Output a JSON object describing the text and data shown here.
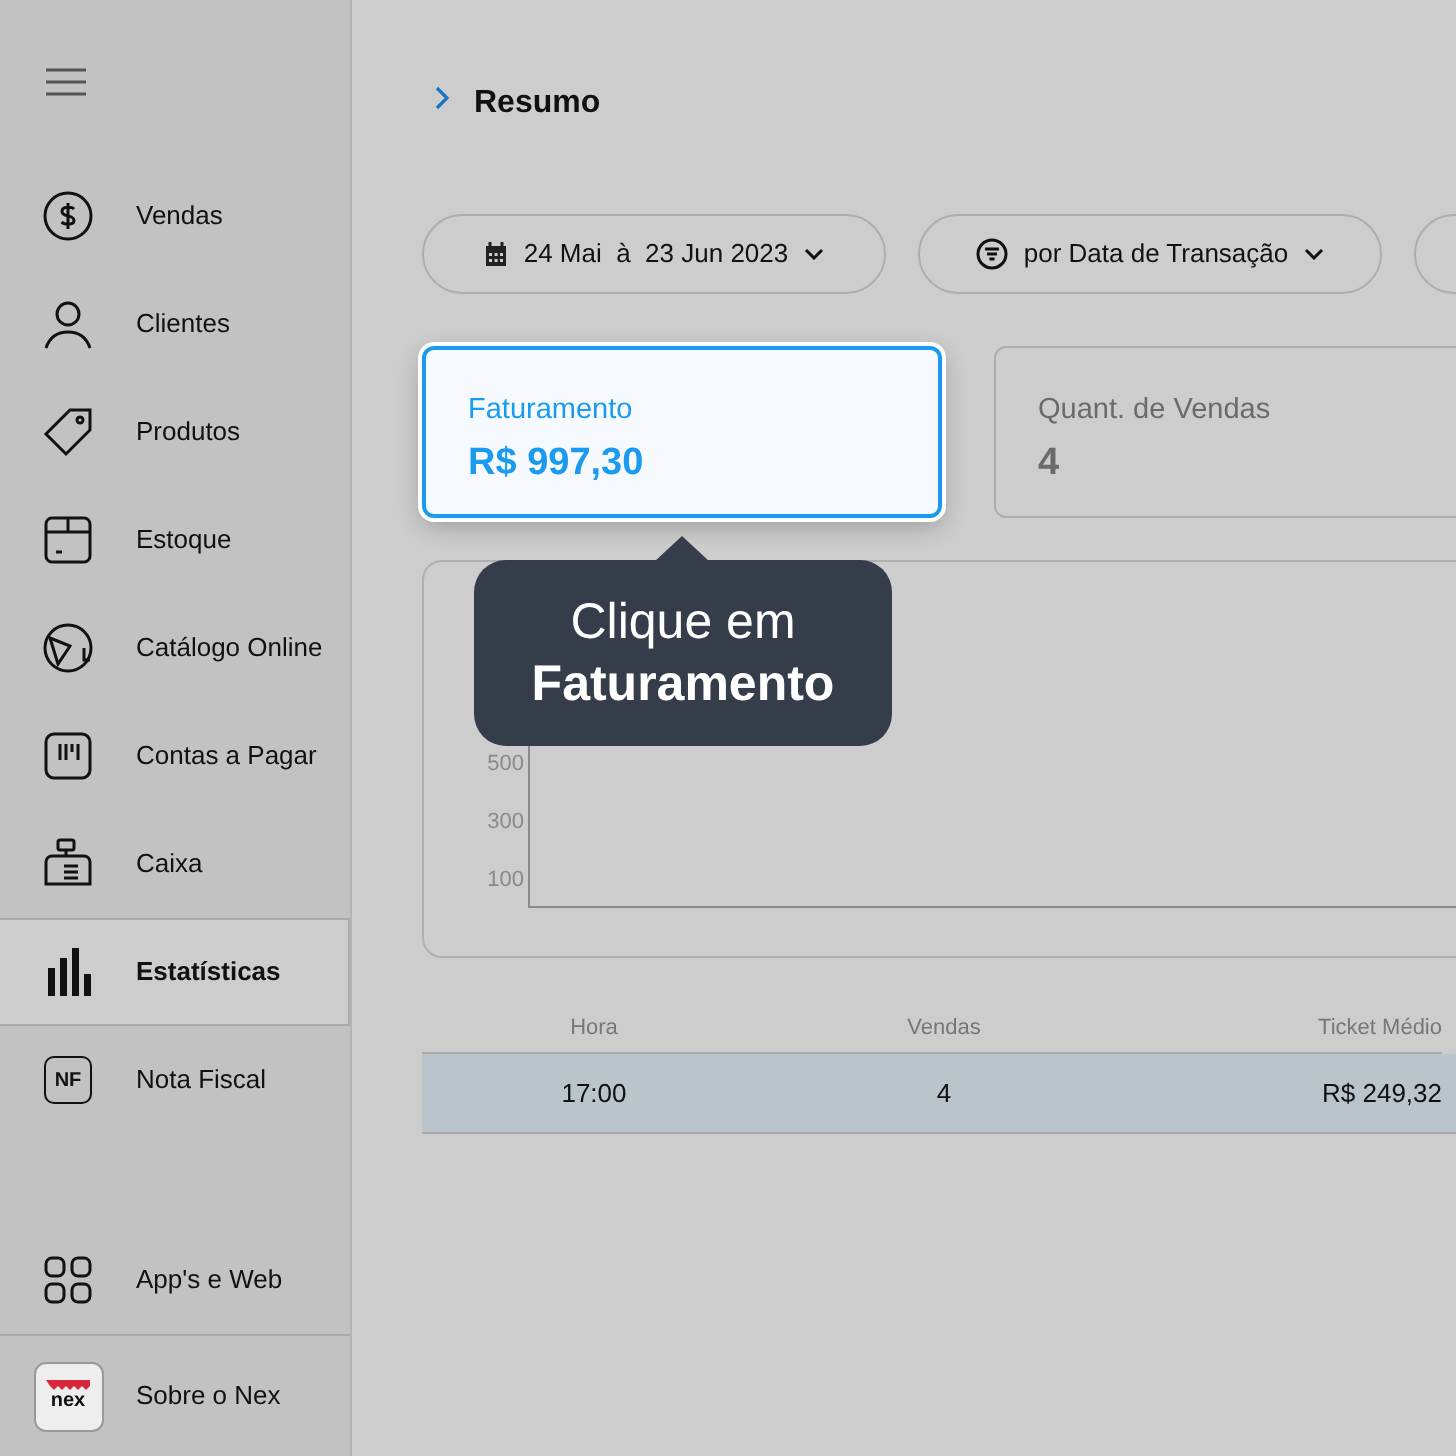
{
  "sidebar": {
    "items": [
      {
        "label": "Vendas",
        "kind": "dollar",
        "selected": false
      },
      {
        "label": "Clientes",
        "kind": "person",
        "selected": false
      },
      {
        "label": "Produtos",
        "kind": "tag",
        "selected": false
      },
      {
        "label": "Estoque",
        "kind": "box",
        "selected": false
      },
      {
        "label": "Catálogo Online",
        "kind": "catalog",
        "selected": false
      },
      {
        "label": "Contas a Pagar",
        "kind": "bill",
        "selected": false
      },
      {
        "label": "Caixa",
        "kind": "register",
        "selected": false
      },
      {
        "label": "Estatísticas",
        "kind": "bars",
        "selected": true
      },
      {
        "label": "Nota Fiscal",
        "kind": "nf",
        "icon_text": "NF",
        "selected": false
      }
    ],
    "apps": {
      "label": "App's e Web"
    },
    "about": {
      "label": "Sobre o Nex",
      "logo_text": "nex"
    }
  },
  "header": {
    "title": "Resumo"
  },
  "filters": [
    {
      "label": "24 Mai  à  23 Jun 2023",
      "kind": "calendar"
    },
    {
      "label": "por Data de Transação",
      "kind": "filter"
    }
  ],
  "cards": [
    {
      "title": "Faturamento",
      "value": "R$ 997,30",
      "selected": true
    },
    {
      "title": "Quant. de Vendas",
      "value": "4",
      "selected": false
    }
  ],
  "chart": {
    "y_ticks": [
      "500",
      "300",
      "100"
    ]
  },
  "tooltip": {
    "text": "Clique em\n**Faturamento**"
  },
  "table": {
    "columns": [
      "Hora",
      "Vendas",
      "Ticket Médio"
    ],
    "rows": [
      [
        "17:00",
        "4",
        "R$ 249,32"
      ]
    ]
  }
}
